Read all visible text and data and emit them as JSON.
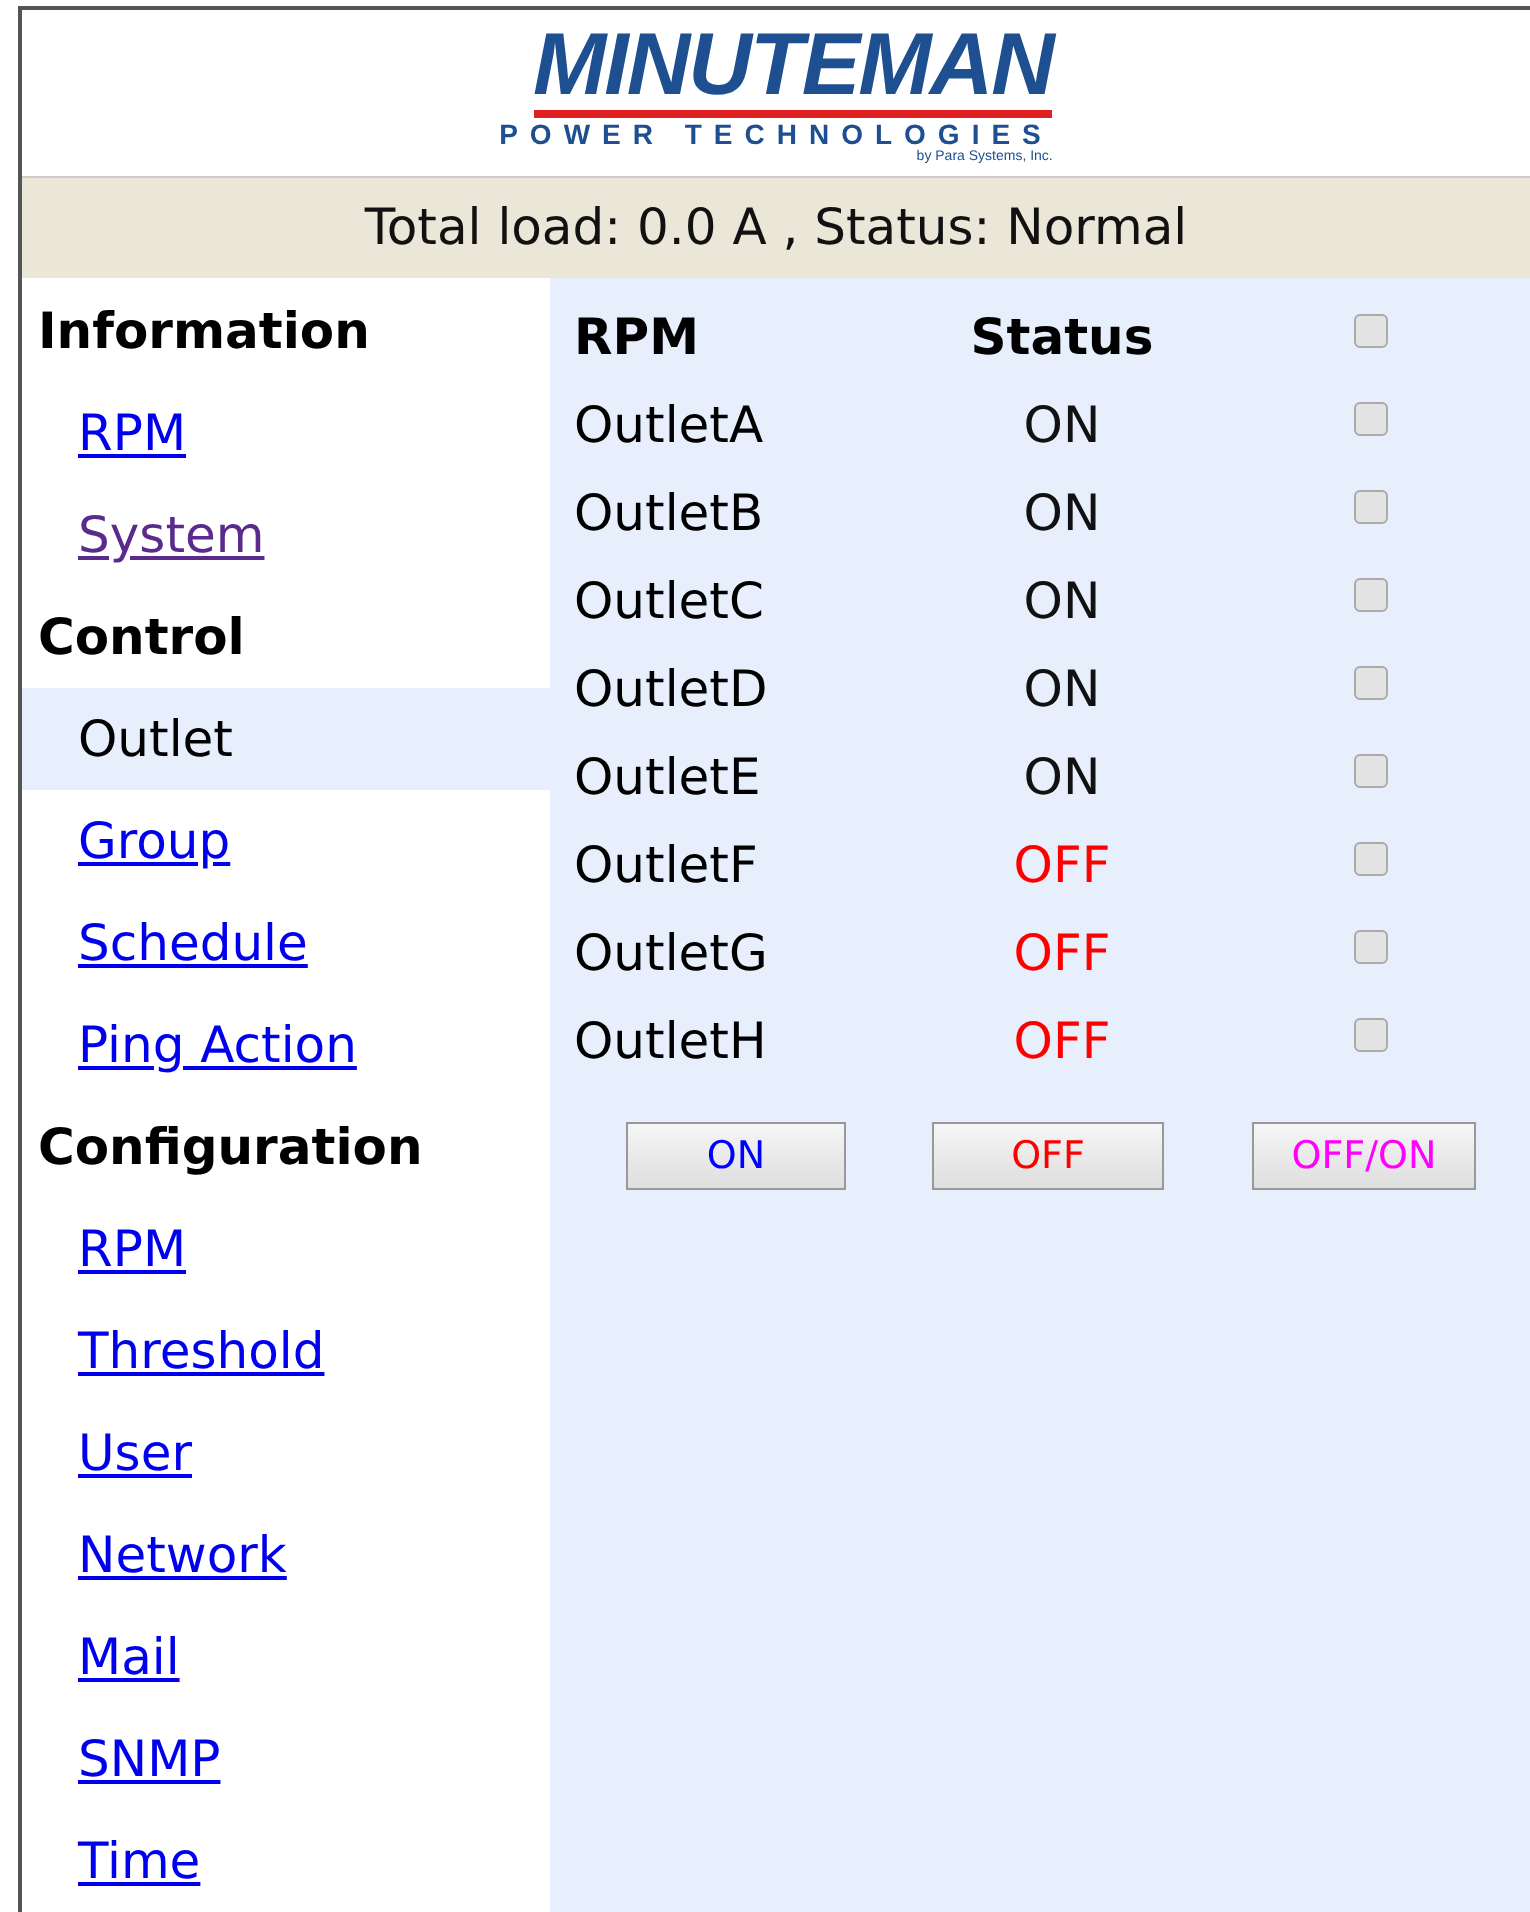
{
  "logo": {
    "brand": "MINUTEMAN",
    "tagline": "POWER TECHNOLOGIES",
    "byline": "by Para Systems, Inc."
  },
  "status_bar": "Total load: 0.0 A , Status: Normal",
  "sidebar": {
    "items": [
      {
        "kind": "heading",
        "label": "Information"
      },
      {
        "kind": "link",
        "label": "RPM",
        "visited": false,
        "selected": false
      },
      {
        "kind": "link",
        "label": "System",
        "visited": true,
        "selected": false
      },
      {
        "kind": "heading",
        "label": "Control"
      },
      {
        "kind": "link",
        "label": "Outlet",
        "selected": true
      },
      {
        "kind": "link",
        "label": "Group",
        "visited": false,
        "selected": false
      },
      {
        "kind": "link",
        "label": "Schedule",
        "visited": false,
        "selected": false
      },
      {
        "kind": "link",
        "label": "Ping Action",
        "visited": false,
        "selected": false
      },
      {
        "kind": "heading",
        "label": "Configuration"
      },
      {
        "kind": "link",
        "label": "RPM",
        "visited": false,
        "selected": false
      },
      {
        "kind": "link",
        "label": "Threshold",
        "visited": false,
        "selected": false
      },
      {
        "kind": "link",
        "label": "User",
        "visited": false,
        "selected": false
      },
      {
        "kind": "link",
        "label": "Network",
        "visited": false,
        "selected": false
      },
      {
        "kind": "link",
        "label": "Mail",
        "visited": false,
        "selected": false
      },
      {
        "kind": "link",
        "label": "SNMP",
        "visited": false,
        "selected": false
      },
      {
        "kind": "link",
        "label": "Time",
        "visited": false,
        "selected": false
      }
    ]
  },
  "table": {
    "columns": [
      "RPM",
      "Status"
    ],
    "select_all": {
      "checked": false
    },
    "rows": [
      {
        "name": "OutletA",
        "status": "ON",
        "on": true,
        "checked": false
      },
      {
        "name": "OutletB",
        "status": "ON",
        "on": true,
        "checked": false
      },
      {
        "name": "OutletC",
        "status": "ON",
        "on": true,
        "checked": false
      },
      {
        "name": "OutletD",
        "status": "ON",
        "on": true,
        "checked": false
      },
      {
        "name": "OutletE",
        "status": "ON",
        "on": true,
        "checked": false
      },
      {
        "name": "OutletF",
        "status": "OFF",
        "on": false,
        "checked": false
      },
      {
        "name": "OutletG",
        "status": "OFF",
        "on": false,
        "checked": false
      },
      {
        "name": "OutletH",
        "status": "OFF",
        "on": false,
        "checked": false
      }
    ]
  },
  "buttons": [
    {
      "label": "ON",
      "color": "#0000ff"
    },
    {
      "label": "OFF",
      "color": "#ff0000"
    },
    {
      "label": "OFF/ON",
      "color": "#ff00ff"
    }
  ]
}
